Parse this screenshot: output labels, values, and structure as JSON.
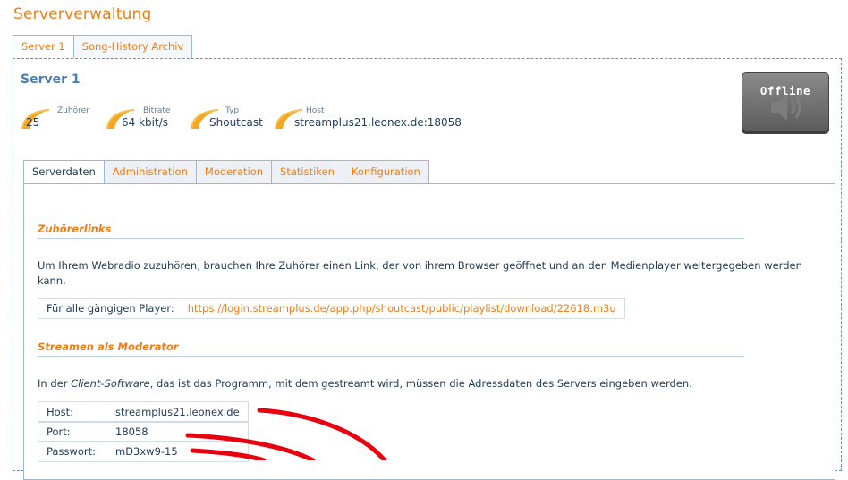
{
  "page": {
    "title": "Serververwaltung"
  },
  "outer_tabs": [
    {
      "label": "Server 1",
      "active": true
    },
    {
      "label": "Song-History Archiv",
      "active": false
    }
  ],
  "server": {
    "title": "Server 1",
    "stats": [
      {
        "label": "Zuhörer",
        "value": "25"
      },
      {
        "label": "Bitrate",
        "value": "64 kbit/s"
      },
      {
        "label": "Typ",
        "value": "Shoutcast"
      },
      {
        "label": "Host",
        "value": "streamplus21.leonex.de:18058"
      }
    ],
    "status_button": {
      "label": "Offline",
      "icon": "speaker-icon"
    }
  },
  "inner_tabs": [
    {
      "label": "Serverdaten",
      "active": true
    },
    {
      "label": "Administration",
      "active": false
    },
    {
      "label": "Moderation",
      "active": false
    },
    {
      "label": "Statistiken",
      "active": false
    },
    {
      "label": "Konfiguration",
      "active": false
    }
  ],
  "listener_section": {
    "heading": "Zuhörerlinks",
    "text": "Um Ihrem Webradio zuzuhören, brauchen Ihre Zuhörer einen Link, der von ihrem Browser geöffnet und an den Medienplayer weitergegeben werden kann.",
    "link_label": "Für alle gängigen Player:",
    "link_url": "https://login.streamplus.de/app.php/shoutcast/public/playlist/download/22618.m3u"
  },
  "moderator_section": {
    "heading": "Streamen als Moderator",
    "text_before": "In der ",
    "text_emph": "Client-Software",
    "text_after": ", das ist das Programm, mit dem gestreamt wird, müssen die Adressdaten des Servers eingeben werden.",
    "fields": [
      {
        "key": "Host:",
        "value": "streamplus21.leonex.de"
      },
      {
        "key": "Port:",
        "value": "18058"
      },
      {
        "key": "Passwort:",
        "value": "mD3xw9-15"
      }
    ]
  },
  "colors": {
    "accent": "#f07d15",
    "text": "#1f3b57",
    "border": "#9bb8d4",
    "annotation": "#e8000e"
  }
}
